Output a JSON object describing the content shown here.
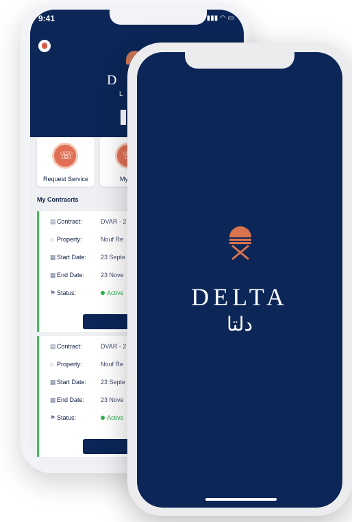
{
  "status_bar": {
    "time": "9:41",
    "icons": "▮▮▮ ◠ ▭"
  },
  "back_header": {
    "brand_partial": "D",
    "sub_partial": "L"
  },
  "services": [
    {
      "label": "Request Service"
    },
    {
      "label": "My Re"
    }
  ],
  "contracts": {
    "title": "My Contracrts",
    "labels": {
      "contract": "Contract:",
      "property": "Property:",
      "start_date": "Start Date:",
      "end_date": "End Date:",
      "status": "Status:"
    },
    "items": [
      {
        "contract": "DVAR - 2",
        "property": "Nouf Re",
        "start_date": "23 Septe",
        "end_date": "23 Nove",
        "status": "Active"
      },
      {
        "contract": "DVAR - 2",
        "property": "Nouf Re",
        "start_date": "23 Septe",
        "end_date": "23 Nove",
        "status": "Active"
      }
    ]
  },
  "splash": {
    "brand": "DELTA",
    "brand_arabic": "دلتا"
  },
  "colors": {
    "navy": "#0b2657",
    "accent": "#d9744f",
    "status_active": "#2bb14a"
  }
}
